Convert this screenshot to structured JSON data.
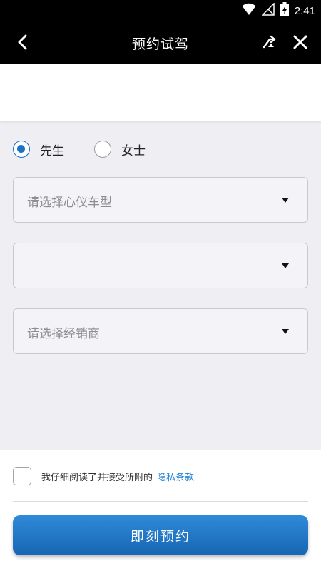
{
  "status_bar": {
    "time": "2:41",
    "icons": [
      "wifi-icon",
      "signal-icon",
      "battery-icon"
    ]
  },
  "app_bar": {
    "title": "预约试驾",
    "icons": [
      "back-arrow-icon",
      "swap-icon",
      "close-icon"
    ]
  },
  "gender": [
    {
      "label": "先生",
      "checked": true
    },
    {
      "label": "女士",
      "checked": false
    }
  ],
  "selects": {
    "model": {
      "placeholder": "请选择心仪车型"
    },
    "city": {
      "placeholder": ""
    },
    "dealer": {
      "placeholder": "请选择经销商"
    }
  },
  "agreement": {
    "text": "我仔细阅读了并接受所附的",
    "link": "隐私条款",
    "checked": false
  },
  "submit": {
    "label": "即刻预约"
  },
  "colors": {
    "accent": "#1a73c6",
    "link": "#2a86d6",
    "header": "#000000",
    "background": "#efeef2"
  }
}
